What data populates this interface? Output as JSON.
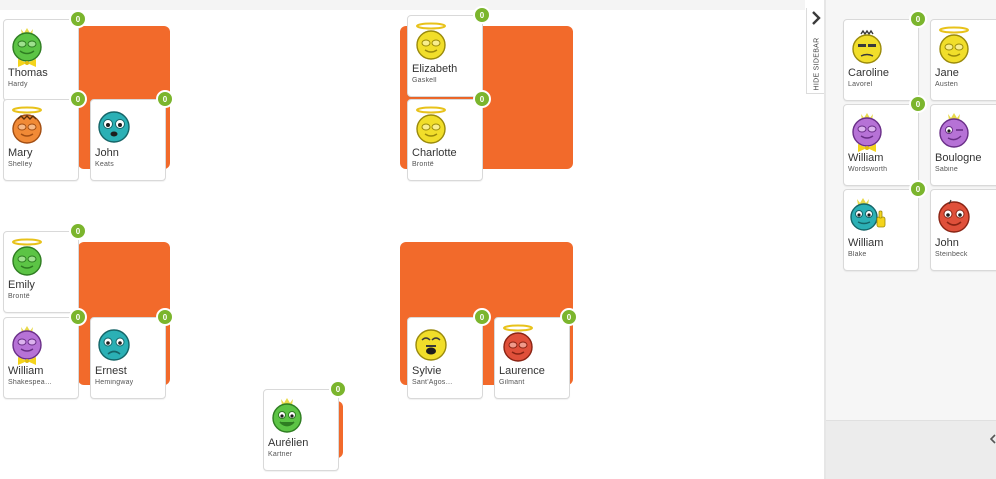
{
  "sidebar": {
    "toggle_label": "HIDE SIDEBAR"
  },
  "colors": {
    "table": "#f26a2b",
    "badge": "#7bb52d"
  },
  "tables": [
    {
      "students": [
        {
          "first": "Thomas",
          "last": "Hardy",
          "points": "0",
          "avatar": "green-smiley-bowtie-icon"
        },
        {
          "first": "Mary",
          "last": "Shelley",
          "points": "0",
          "avatar": "orange-halo-icon"
        },
        {
          "first": "John",
          "last": "Keats",
          "points": "0",
          "avatar": "teal-worried-icon"
        }
      ]
    },
    {
      "students": [
        {
          "first": "Elizabeth",
          "last": "Gaskell",
          "points": "0",
          "avatar": "yellow-halo-icon"
        },
        {
          "first": "Charlotte",
          "last": "Brontë",
          "points": "0",
          "avatar": "yellow-halo-icon"
        }
      ]
    },
    {
      "students": [
        {
          "first": "Emily",
          "last": "Brontë",
          "points": "0",
          "avatar": "green-halo-icon"
        },
        {
          "first": "William",
          "last": "Shakespea…",
          "points": "0",
          "avatar": "purple-bowtie-icon"
        },
        {
          "first": "Ernest",
          "last": "Hemingway",
          "points": "0",
          "avatar": "teal-sad-icon"
        }
      ]
    },
    {
      "students": [
        {
          "first": "Sylvie",
          "last": "Sant'Agos…",
          "points": "0",
          "avatar": "yellow-surprised-icon"
        },
        {
          "first": "Laurence",
          "last": "Gilmant",
          "points": "0",
          "avatar": "red-halo-icon"
        }
      ]
    },
    {
      "students": [
        {
          "first": "Aurélien",
          "last": "Kartner",
          "points": "0",
          "avatar": "green-happy-icon"
        }
      ]
    }
  ],
  "unassigned": [
    {
      "first": "Caroline",
      "last": "Lavorel",
      "points": "0",
      "avatar": "yellow-grumpy-icon"
    },
    {
      "first": "Jane",
      "last": "Austen",
      "points": "0",
      "avatar": "yellow-halo-icon"
    },
    {
      "first": "William",
      "last": "Wordsworth",
      "points": "0",
      "avatar": "purple-bowtie-icon"
    },
    {
      "first": "Boulogne",
      "last": "Sabine",
      "points": "0",
      "avatar": "purple-wink-icon"
    },
    {
      "first": "William",
      "last": "Blake",
      "points": "0",
      "avatar": "teal-thumbsup-icon"
    },
    {
      "first": "John",
      "last": "Steinbeck",
      "points": "0",
      "avatar": "red-happy-icon"
    }
  ]
}
